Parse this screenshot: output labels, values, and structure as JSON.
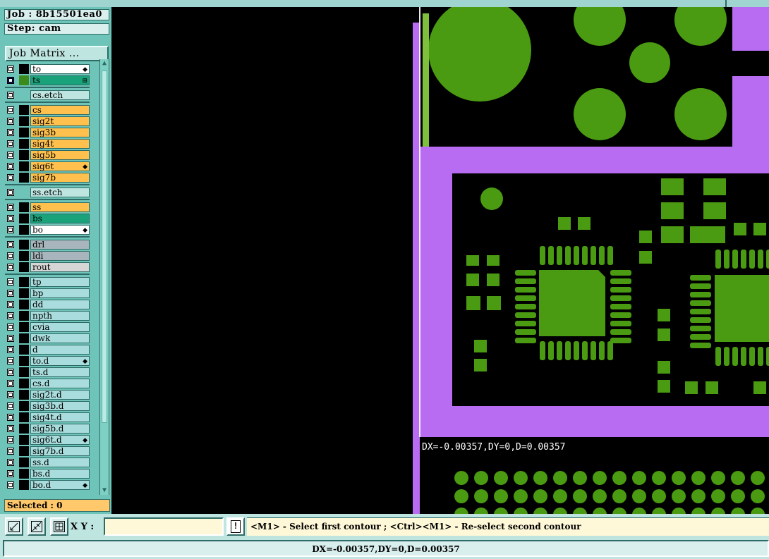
{
  "panel": {
    "job_label": "Job : 8b15501ea0",
    "step_label": "Step: cam",
    "job_matrix_button": "Job Matrix ...",
    "selected_label": "Selected : 0"
  },
  "layers": [
    {
      "name": "to",
      "bg": "#ffffff",
      "mark": "◆",
      "swatch": "#000000",
      "row": 0,
      "checked": false
    },
    {
      "name": "ts",
      "bg": "#1aa37a",
      "mark": "⊞",
      "swatch": "#3a8a1c",
      "row": 1,
      "checked": true,
      "swatch_left": "#101880"
    },
    {
      "name": "cs.etch",
      "bg": "#bfe5e1",
      "mark": "",
      "swatch": "",
      "row": 2
    },
    {
      "name": "cs",
      "bg": "#ffc04d",
      "mark": "",
      "swatch": "#000000",
      "row": 3
    },
    {
      "name": "sig2t",
      "bg": "#ffc04d",
      "mark": "",
      "swatch": "#000000",
      "row": 4
    },
    {
      "name": "sig3b",
      "bg": "#ffc04d",
      "mark": "",
      "swatch": "#000000",
      "row": 5
    },
    {
      "name": "sig4t",
      "bg": "#ffc04d",
      "mark": "",
      "swatch": "#000000",
      "row": 6
    },
    {
      "name": "sig5b",
      "bg": "#ffc04d",
      "mark": "",
      "swatch": "#000000",
      "row": 7
    },
    {
      "name": "sig6t",
      "bg": "#ffc04d",
      "mark": "◆",
      "swatch": "#000000",
      "row": 8
    },
    {
      "name": "sig7b",
      "bg": "#ffc04d",
      "mark": "",
      "swatch": "#000000",
      "row": 9
    },
    {
      "name": "ss.etch",
      "bg": "#bfe5e1",
      "mark": "",
      "swatch": "",
      "row": 10
    },
    {
      "name": "ss",
      "bg": "#ffc04d",
      "mark": "",
      "swatch": "#000000",
      "row": 11
    },
    {
      "name": "bs",
      "bg": "#1aa37a",
      "mark": "",
      "swatch": "#000000",
      "row": 12
    },
    {
      "name": "bo",
      "bg": "#ffffff",
      "mark": "◆",
      "swatch": "#000000",
      "row": 13
    },
    {
      "name": "drl",
      "bg": "#a9b5bc",
      "mark": "",
      "swatch": "#000000",
      "row": 14
    },
    {
      "name": "ldi",
      "bg": "#a9b5bc",
      "mark": "",
      "swatch": "#000000",
      "row": 15
    },
    {
      "name": "rout",
      "bg": "#d6d6d6",
      "mark": "",
      "swatch": "#000000",
      "row": 16
    },
    {
      "name": "tp",
      "bg": "#a9dcdc",
      "mark": "",
      "swatch": "#000000",
      "row": 17
    },
    {
      "name": "bp",
      "bg": "#a9dcdc",
      "mark": "",
      "swatch": "#000000",
      "row": 18
    },
    {
      "name": "dd",
      "bg": "#a9dcdc",
      "mark": "",
      "swatch": "#000000",
      "row": 19
    },
    {
      "name": "npth",
      "bg": "#a9dcdc",
      "mark": "",
      "swatch": "#000000",
      "row": 20
    },
    {
      "name": "cvia",
      "bg": "#a9dcdc",
      "mark": "",
      "swatch": "#000000",
      "row": 21
    },
    {
      "name": "dwk",
      "bg": "#a9dcdc",
      "mark": "",
      "swatch": "#000000",
      "row": 22
    },
    {
      "name": "d",
      "bg": "#a9dcdc",
      "mark": "",
      "swatch": "#000000",
      "row": 23
    },
    {
      "name": "to.d",
      "bg": "#a9dcdc",
      "mark": "◆",
      "swatch": "#000000",
      "row": 24
    },
    {
      "name": "ts.d",
      "bg": "#a9dcdc",
      "mark": "",
      "swatch": "#000000",
      "row": 25
    },
    {
      "name": "cs.d",
      "bg": "#a9dcdc",
      "mark": "",
      "swatch": "#000000",
      "row": 26
    },
    {
      "name": "sig2t.d",
      "bg": "#a9dcdc",
      "mark": "",
      "swatch": "#000000",
      "row": 27
    },
    {
      "name": "sig3b.d",
      "bg": "#a9dcdc",
      "mark": "",
      "swatch": "#000000",
      "row": 28
    },
    {
      "name": "sig4t.d",
      "bg": "#a9dcdc",
      "mark": "",
      "swatch": "#000000",
      "row": 29
    },
    {
      "name": "sig5b.d",
      "bg": "#a9dcdc",
      "mark": "",
      "swatch": "#000000",
      "row": 30
    },
    {
      "name": "sig6t.d",
      "bg": "#a9dcdc",
      "mark": "◆",
      "swatch": "#000000",
      "row": 31
    },
    {
      "name": "sig7b.d",
      "bg": "#a9dcdc",
      "mark": "",
      "swatch": "#000000",
      "row": 32
    },
    {
      "name": "ss.d",
      "bg": "#a9dcdc",
      "mark": "",
      "swatch": "#000000",
      "row": 33
    },
    {
      "name": "bs.d",
      "bg": "#a9dcdc",
      "mark": "",
      "swatch": "#000000",
      "row": 34
    },
    {
      "name": "bo.d",
      "bg": "#a9dcdc",
      "mark": "◆",
      "swatch": "#000000",
      "row": 35
    }
  ],
  "canvas": {
    "measure_readout": "DX=-0.00357,DY=0,D=0.00357",
    "colors": {
      "copper": "#4a9a12",
      "outline": "#b86cf2",
      "background": "#000000"
    }
  },
  "toolbar": {
    "xy_label": "X Y :",
    "xy_value": "",
    "bang_label": "!",
    "tool_icons": [
      "snap-diagonal-icon",
      "snap-midpoint-icon",
      "snap-grid-icon"
    ]
  },
  "prompt": "<M1> - Select first contour ; <Ctrl><M1> - Re-select second contour",
  "status_bar": "DX=-0.00357,DY=0,D=0.00357"
}
